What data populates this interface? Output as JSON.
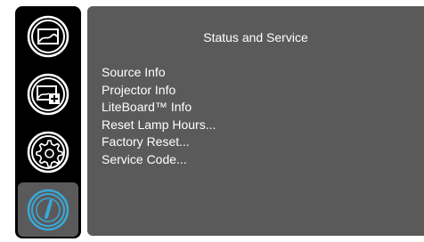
{
  "sidebar": {
    "items": [
      {
        "name": "picture-menu",
        "icon": "picture-icon",
        "active": false
      },
      {
        "name": "setup-menu",
        "icon": "picture-plus-icon",
        "active": false
      },
      {
        "name": "settings-menu",
        "icon": "gear-icon",
        "active": false
      },
      {
        "name": "info-menu",
        "icon": "info-icon",
        "active": true
      }
    ]
  },
  "panel": {
    "title": "Status and Service",
    "items": [
      "Source Info",
      "Projector Info",
      "LiteBoard™ Info",
      "Reset Lamp Hours...",
      "Factory Reset...",
      "Service Code..."
    ]
  },
  "colors": {
    "background": "#000000",
    "panel": "#5a5a5a",
    "text": "#ffffff",
    "icon_outline": "#ffffff",
    "active_icon": "#3aa8d8"
  }
}
